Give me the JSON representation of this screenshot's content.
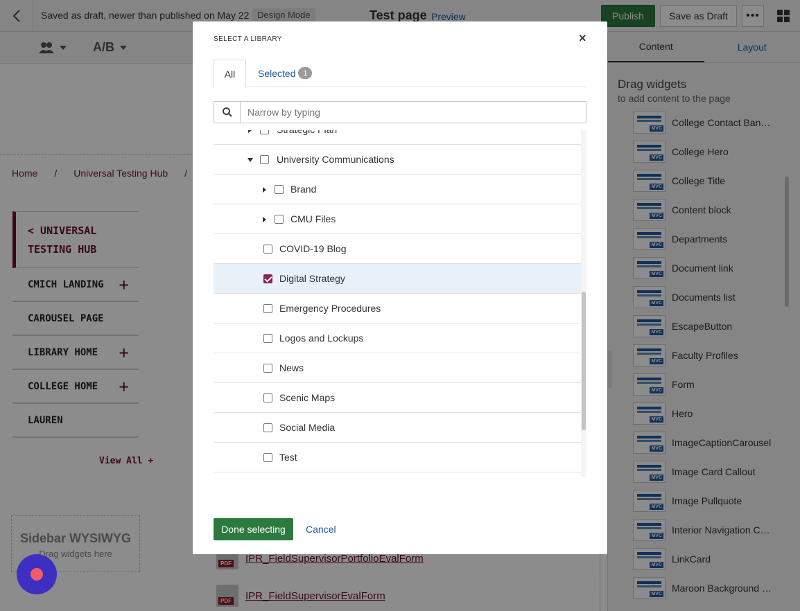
{
  "topbar": {
    "status": "Saved as draft, newer than published on May 22",
    "mode": "Design Mode",
    "page_title": "Test page",
    "preview": "Preview",
    "publish": "Publish",
    "save_draft": "Save as Draft",
    "more": "•••"
  },
  "subbar": {
    "ab_label": "A/B"
  },
  "breadcrumb": [
    "Home",
    "Universal Testing Hub"
  ],
  "leftnav": {
    "head_line1": "< UNIVERSAL",
    "head_line2": "TESTING HUB",
    "items": [
      {
        "label": "CMICH LANDING",
        "plus": true
      },
      {
        "label": "CAROUSEL PAGE",
        "plus": false
      },
      {
        "label": "LIBRARY HOME",
        "plus": true
      },
      {
        "label": "COLLEGE HOME",
        "plus": true
      },
      {
        "label": "LAUREN",
        "plus": false
      }
    ],
    "view_all": "View All +"
  },
  "sidebar_wysiwyg": {
    "title": "Sidebar WYSIWYG",
    "subtitle": "Drag widgets here"
  },
  "files": [
    "IPR_FieldSupervisorPortfolioEvalForm",
    "IPR_FieldSupervisorEvalForm"
  ],
  "file_tag": "PDF",
  "right_panel": {
    "tab_content": "Content",
    "tab_layout": "Layout",
    "drag_title": "Drag widgets",
    "drag_subtitle": "to add content to the page",
    "widget_tag": "MVC",
    "widgets": [
      "College Contact Bann…",
      "College Hero",
      "College Title",
      "Content block",
      "Departments",
      "Document link",
      "Documents list",
      "EscapeButton",
      "Faculty Profiles",
      "Form",
      "Hero",
      "ImageCaptionCarousel",
      "Image Card Callout",
      "Image Pullquote",
      "Interior Navigation C…",
      "LinkCard",
      "Maroon Background …"
    ]
  },
  "modal": {
    "title": "SELECT A LIBRARY",
    "close": "×",
    "tab_all": "All",
    "tab_selected": "Selected",
    "selected_count": "1",
    "search_placeholder": "Narrow by typing",
    "rows": [
      {
        "label": "Strategic Plan",
        "level": 0,
        "expander": "right",
        "checked": false
      },
      {
        "label": "University Communications",
        "level": 0,
        "expander": "down",
        "checked": false
      },
      {
        "label": "Brand",
        "level": 1,
        "expander": "right",
        "checked": false
      },
      {
        "label": "CMU Files",
        "level": 1,
        "expander": "right",
        "checked": false
      },
      {
        "label": "COVID-19 Blog",
        "level": 1,
        "expander": "none",
        "checked": false
      },
      {
        "label": "Digital Strategy",
        "level": 1,
        "expander": "none",
        "checked": true
      },
      {
        "label": "Emergency Procedures",
        "level": 1,
        "expander": "none",
        "checked": false
      },
      {
        "label": "Logos and Lockups",
        "level": 1,
        "expander": "none",
        "checked": false
      },
      {
        "label": "News",
        "level": 1,
        "expander": "none",
        "checked": false
      },
      {
        "label": "Scenic Maps",
        "level": 1,
        "expander": "none",
        "checked": false
      },
      {
        "label": "Social Media",
        "level": 1,
        "expander": "none",
        "checked": false
      },
      {
        "label": "Test",
        "level": 1,
        "expander": "none",
        "checked": false
      }
    ],
    "done": "Done selecting",
    "cancel": "Cancel"
  }
}
